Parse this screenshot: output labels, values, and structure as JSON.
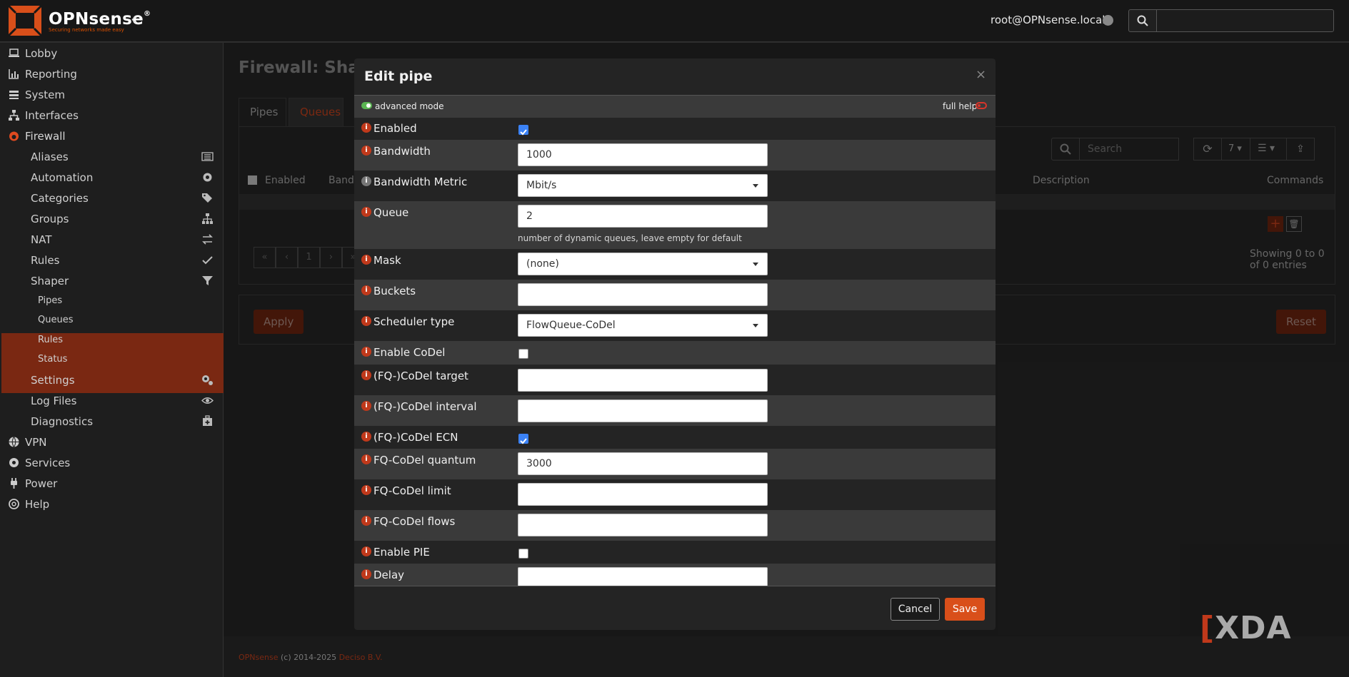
{
  "app": {
    "brand": "OPNsense",
    "registered": "®",
    "tagline": "Securing networks made easy",
    "user": "root@OPNsense.local"
  },
  "sidebar": {
    "items": [
      {
        "label": "Lobby"
      },
      {
        "label": "Reporting"
      },
      {
        "label": "System"
      },
      {
        "label": "Interfaces"
      },
      {
        "label": "Firewall"
      },
      {
        "label": "Aliases"
      },
      {
        "label": "Automation"
      },
      {
        "label": "Categories"
      },
      {
        "label": "Groups"
      },
      {
        "label": "NAT"
      },
      {
        "label": "Rules"
      },
      {
        "label": "Shaper"
      },
      {
        "label": "Pipes"
      },
      {
        "label": "Queues"
      },
      {
        "label": "Rules"
      },
      {
        "label": "Status"
      },
      {
        "label": "Settings"
      },
      {
        "label": "Log Files"
      },
      {
        "label": "Diagnostics"
      },
      {
        "label": "VPN"
      },
      {
        "label": "Services"
      },
      {
        "label": "Power"
      },
      {
        "label": "Help"
      }
    ]
  },
  "page": {
    "title": "Firewall: Shape",
    "tabs": [
      "Pipes",
      "Queues"
    ],
    "table": {
      "columns": [
        "Enabled",
        "Bandw",
        "Description",
        "Commands"
      ],
      "search_placeholder": "Search",
      "page_size": "7",
      "pager": [
        "«",
        "‹",
        "1",
        "›",
        "»"
      ],
      "info": "Showing 0 to 0 of 0 entries"
    },
    "apply": "Apply",
    "reset": "Reset"
  },
  "footer": {
    "brand": "OPNsense",
    "copy": " (c) 2014-2025 ",
    "company": "Deciso B.V."
  },
  "modal": {
    "title": "Edit pipe",
    "close": "×",
    "advanced_mode": "advanced mode",
    "full_help": "full help",
    "fields": {
      "enabled": {
        "label": "Enabled",
        "checked": true
      },
      "bandwidth": {
        "label": "Bandwidth",
        "value": "1000"
      },
      "bandwidth_metric": {
        "label": "Bandwidth Metric",
        "value": "Mbit/s"
      },
      "queue": {
        "label": "Queue",
        "value": "2",
        "help": "number of dynamic queues, leave empty for default"
      },
      "mask": {
        "label": "Mask",
        "value": "(none)"
      },
      "buckets": {
        "label": "Buckets",
        "value": ""
      },
      "scheduler": {
        "label": "Scheduler type",
        "value": "FlowQueue-CoDel"
      },
      "enable_codel": {
        "label": "Enable CoDel",
        "checked": false
      },
      "codel_target": {
        "label": "(FQ-)CoDel target",
        "value": ""
      },
      "codel_interval": {
        "label": "(FQ-)CoDel interval",
        "value": ""
      },
      "codel_ecn": {
        "label": "(FQ-)CoDel ECN",
        "checked": true
      },
      "fq_quantum": {
        "label": "FQ-CoDel quantum",
        "value": "3000"
      },
      "fq_limit": {
        "label": "FQ-CoDel limit",
        "value": ""
      },
      "fq_flows": {
        "label": "FQ-CoDel flows",
        "value": ""
      },
      "enable_pie": {
        "label": "Enable PIE",
        "checked": false
      },
      "delay": {
        "label": "Delay",
        "value": ""
      }
    },
    "cancel": "Cancel",
    "save": "Save"
  },
  "watermark": "XDA",
  "colors": {
    "accent": "#d94f1a",
    "active_nav": "#7a2812",
    "checkbox": "#3b82f6"
  }
}
